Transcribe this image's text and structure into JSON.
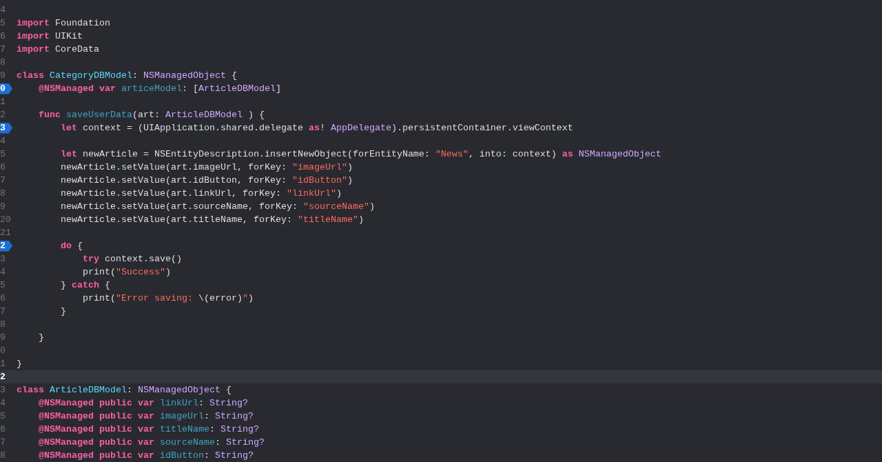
{
  "editor": {
    "lines": [
      {
        "number": "4",
        "breakpoint": false,
        "current": false
      },
      {
        "number": "5",
        "breakpoint": false,
        "current": false,
        "tokens": [
          {
            "kind": "keyword",
            "text": "import"
          },
          {
            "kind": "plain",
            "text": " Foundation"
          }
        ]
      },
      {
        "number": "6",
        "breakpoint": false,
        "current": false,
        "tokens": [
          {
            "kind": "keyword",
            "text": "import"
          },
          {
            "kind": "plain",
            "text": " UIKit"
          }
        ]
      },
      {
        "number": "7",
        "breakpoint": false,
        "current": false,
        "tokens": [
          {
            "kind": "keyword",
            "text": "import"
          },
          {
            "kind": "plain",
            "text": " CoreData"
          }
        ]
      },
      {
        "number": "8",
        "breakpoint": false,
        "current": false
      },
      {
        "number": "9",
        "breakpoint": false,
        "current": false,
        "tokens": [
          {
            "kind": "keyword",
            "text": "class"
          },
          {
            "kind": "type_declaration",
            "text": " CategoryDBModel"
          },
          {
            "kind": "plain",
            "text": ": "
          },
          {
            "kind": "type",
            "text": "NSManagedObject"
          },
          {
            "kind": "plain",
            "text": " {"
          }
        ]
      },
      {
        "number": "0",
        "breakpoint": true,
        "current": false,
        "tokens": [
          {
            "kind": "keyword",
            "text": "    @NSManaged var"
          },
          {
            "kind": "declaration",
            "text": " articeModel"
          },
          {
            "kind": "plain",
            "text": ": ["
          },
          {
            "kind": "type",
            "text": "ArticleDBModel"
          },
          {
            "kind": "plain",
            "text": "]"
          }
        ]
      },
      {
        "number": "1",
        "breakpoint": false,
        "current": false
      },
      {
        "number": "2",
        "breakpoint": false,
        "current": false,
        "tokens": [
          {
            "kind": "keyword",
            "text": "    func"
          },
          {
            "kind": "declaration",
            "text": " saveUserData"
          },
          {
            "kind": "plain",
            "text": "(art: "
          },
          {
            "kind": "type",
            "text": "ArticleDBModel"
          },
          {
            "kind": "plain",
            "text": " ) {"
          }
        ]
      },
      {
        "number": "3",
        "breakpoint": true,
        "current": false,
        "tokens": [
          {
            "kind": "keyword",
            "text": "        let"
          },
          {
            "kind": "plain",
            "text": " context = (UIApplication.shared.delegate "
          },
          {
            "kind": "keyword",
            "text": "as"
          },
          {
            "kind": "plain",
            "text": "! "
          },
          {
            "kind": "type",
            "text": "AppDelegate"
          },
          {
            "kind": "plain",
            "text": ").persistentContainer.viewContext"
          }
        ]
      },
      {
        "number": "4",
        "breakpoint": false,
        "current": false
      },
      {
        "number": "5",
        "breakpoint": false,
        "current": false,
        "tokens": [
          {
            "kind": "keyword",
            "text": "        let"
          },
          {
            "kind": "plain",
            "text": " newArticle = NSEntityDescription.insertNewObject(forEntityName: "
          },
          {
            "kind": "string",
            "text": "\"News\""
          },
          {
            "kind": "plain",
            "text": ", into: context) "
          },
          {
            "kind": "keyword",
            "text": "as"
          },
          {
            "kind": "type",
            "text": " NSManagedObject"
          }
        ]
      },
      {
        "number": "6",
        "breakpoint": false,
        "current": false,
        "tokens": [
          {
            "kind": "plain",
            "text": "        newArticle.setValue(art.imageUrl, forKey: "
          },
          {
            "kind": "string",
            "text": "\"imageUrl\""
          },
          {
            "kind": "plain",
            "text": ")"
          }
        ]
      },
      {
        "number": "7",
        "breakpoint": false,
        "current": false,
        "tokens": [
          {
            "kind": "plain",
            "text": "        newArticle.setValue(art.idButton, forKey: "
          },
          {
            "kind": "string",
            "text": "\"idButton\""
          },
          {
            "kind": "plain",
            "text": ")"
          }
        ]
      },
      {
        "number": "8",
        "breakpoint": false,
        "current": false,
        "tokens": [
          {
            "kind": "plain",
            "text": "        newArticle.setValue(art.linkUrl, forKey: "
          },
          {
            "kind": "string",
            "text": "\"linkUrl\""
          },
          {
            "kind": "plain",
            "text": ")"
          }
        ]
      },
      {
        "number": "9",
        "breakpoint": false,
        "current": false,
        "tokens": [
          {
            "kind": "plain",
            "text": "        newArticle.setValue(art.sourceName, forKey: "
          },
          {
            "kind": "string",
            "text": "\"sourceName\""
          },
          {
            "kind": "plain",
            "text": ")"
          }
        ]
      },
      {
        "number": "20",
        "breakpoint": false,
        "current": false,
        "tokens": [
          {
            "kind": "plain",
            "text": "        newArticle.setValue(art.titleName, forKey: "
          },
          {
            "kind": "string",
            "text": "\"titleName\""
          },
          {
            "kind": "plain",
            "text": ")"
          }
        ]
      },
      {
        "number": "21",
        "breakpoint": false,
        "current": false
      },
      {
        "number": "2",
        "breakpoint": true,
        "current": false,
        "tokens": [
          {
            "kind": "keyword",
            "text": "        do"
          },
          {
            "kind": "plain",
            "text": " {"
          }
        ]
      },
      {
        "number": "3",
        "breakpoint": false,
        "current": false,
        "tokens": [
          {
            "kind": "keyword",
            "text": "            try"
          },
          {
            "kind": "plain",
            "text": " context.save()"
          }
        ]
      },
      {
        "number": "4",
        "breakpoint": false,
        "current": false,
        "tokens": [
          {
            "kind": "plain",
            "text": "            print("
          },
          {
            "kind": "string",
            "text": "\"Success\""
          },
          {
            "kind": "plain",
            "text": ")"
          }
        ]
      },
      {
        "number": "5",
        "breakpoint": false,
        "current": false,
        "tokens": [
          {
            "kind": "plain",
            "text": "        } "
          },
          {
            "kind": "keyword",
            "text": "catch"
          },
          {
            "kind": "plain",
            "text": " {"
          }
        ]
      },
      {
        "number": "6",
        "breakpoint": false,
        "current": false,
        "tokens": [
          {
            "kind": "plain",
            "text": "            print("
          },
          {
            "kind": "string",
            "text": "\"Error saving: "
          },
          {
            "kind": "plain",
            "text": "\\(error)"
          },
          {
            "kind": "string",
            "text": "\""
          },
          {
            "kind": "plain",
            "text": ")"
          }
        ]
      },
      {
        "number": "7",
        "breakpoint": false,
        "current": false,
        "tokens": [
          {
            "kind": "plain",
            "text": "        }"
          }
        ]
      },
      {
        "number": "8",
        "breakpoint": false,
        "current": false
      },
      {
        "number": "9",
        "breakpoint": false,
        "current": false,
        "tokens": [
          {
            "kind": "plain",
            "text": "    }"
          }
        ]
      },
      {
        "number": "0",
        "breakpoint": false,
        "current": false
      },
      {
        "number": "1",
        "breakpoint": false,
        "current": false,
        "tokens": [
          {
            "kind": "plain",
            "text": "}"
          }
        ]
      },
      {
        "number": "2",
        "breakpoint": false,
        "current": true
      },
      {
        "number": "3",
        "breakpoint": false,
        "current": false,
        "tokens": [
          {
            "kind": "keyword",
            "text": "class"
          },
          {
            "kind": "type_declaration",
            "text": " ArticleDBModel"
          },
          {
            "kind": "plain",
            "text": ": "
          },
          {
            "kind": "type",
            "text": "NSManagedObject"
          },
          {
            "kind": "plain",
            "text": " {"
          }
        ]
      },
      {
        "number": "4",
        "breakpoint": false,
        "current": false,
        "tokens": [
          {
            "kind": "keyword",
            "text": "    @NSManaged public var"
          },
          {
            "kind": "declaration",
            "text": " linkUrl"
          },
          {
            "kind": "plain",
            "text": ": "
          },
          {
            "kind": "type",
            "text": "String?"
          }
        ]
      },
      {
        "number": "5",
        "breakpoint": false,
        "current": false,
        "tokens": [
          {
            "kind": "keyword",
            "text": "    @NSManaged public var"
          },
          {
            "kind": "declaration",
            "text": " imageUrl"
          },
          {
            "kind": "plain",
            "text": ": "
          },
          {
            "kind": "type",
            "text": "String?"
          }
        ]
      },
      {
        "number": "6",
        "breakpoint": false,
        "current": false,
        "tokens": [
          {
            "kind": "keyword",
            "text": "    @NSManaged public var"
          },
          {
            "kind": "declaration",
            "text": " titleName"
          },
          {
            "kind": "plain",
            "text": ": "
          },
          {
            "kind": "type",
            "text": "String?"
          }
        ]
      },
      {
        "number": "7",
        "breakpoint": false,
        "current": false,
        "tokens": [
          {
            "kind": "keyword",
            "text": "    @NSManaged public var"
          },
          {
            "kind": "declaration",
            "text": " sourceName"
          },
          {
            "kind": "plain",
            "text": ": "
          },
          {
            "kind": "type",
            "text": "String?"
          }
        ]
      },
      {
        "number": "8",
        "breakpoint": false,
        "current": false,
        "tokens": [
          {
            "kind": "keyword",
            "text": "    @NSManaged public var"
          },
          {
            "kind": "declaration",
            "text": " idButton"
          },
          {
            "kind": "plain",
            "text": ": "
          },
          {
            "kind": "type",
            "text": "String?"
          }
        ]
      }
    ]
  }
}
